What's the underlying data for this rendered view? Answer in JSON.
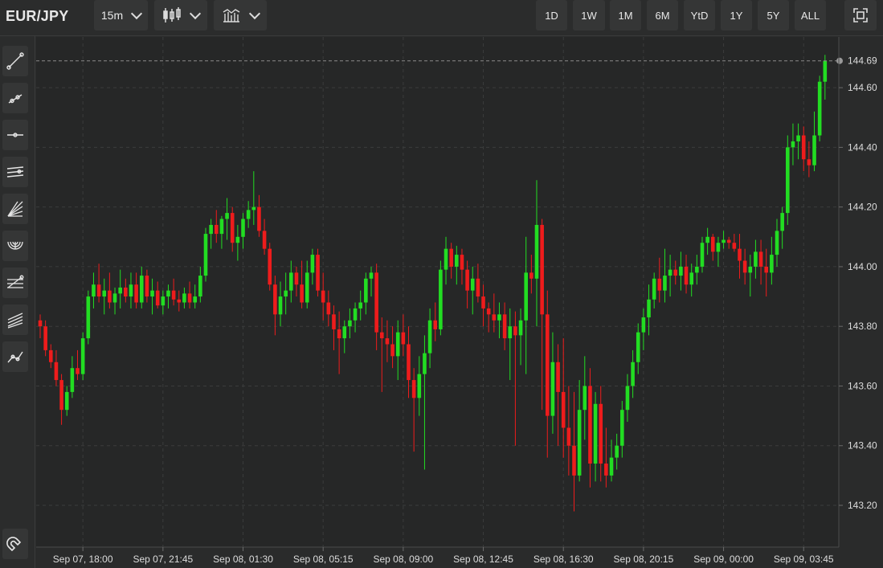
{
  "header": {
    "symbol": "EUR/JPY",
    "interval_label": "15m",
    "chart_style_icon": "candlestick-icon",
    "indicators_icon": "indicators-icon",
    "ranges": [
      "1D",
      "1W",
      "1M",
      "6M",
      "YtD",
      "1Y",
      "5Y",
      "ALL"
    ],
    "fullscreen_icon": "fullscreen-icon"
  },
  "sidebar": {
    "tools": [
      "trend-line-icon",
      "ray-icon",
      "horizontal-line-icon",
      "parallel-channel-icon",
      "fibonacci-fan-icon",
      "fibonacci-arcs-icon",
      "fibonacci-retracement-icon",
      "pitchfork-icon",
      "polyline-icon"
    ],
    "bottom_tool": "magnet-icon"
  },
  "colors": {
    "background": "#262727",
    "up": "#22dd22",
    "down": "#ee1c1c",
    "grid": "#3b3c3c",
    "price_line": "#8a8a8a"
  },
  "chart_data": {
    "type": "candlestick",
    "symbol": "EUR/JPY",
    "interval": "15m",
    "last_price": 144.69,
    "y_ticks": [
      143.2,
      143.4,
      143.6,
      143.8,
      144.0,
      144.2,
      144.4,
      144.6
    ],
    "y_tick_labels": [
      "143.20",
      "143.40",
      "143.60",
      "143.80",
      "144.00",
      "144.20",
      "144.40",
      "144.60"
    ],
    "ylim": [
      143.06,
      144.77
    ],
    "x_tick_labels": [
      "Sep 07, 18:00",
      "Sep 07, 21:45",
      "Sep 08, 01:30",
      "Sep 08, 05:15",
      "Sep 08, 09:00",
      "Sep 08, 12:45",
      "Sep 08, 16:30",
      "Sep 08, 20:15",
      "Sep 09, 00:00",
      "Sep 09, 03:45"
    ],
    "x_tick_bar_index": [
      8,
      23,
      38,
      53,
      68,
      83,
      98,
      113,
      128,
      143
    ],
    "grid": true,
    "candles": [
      [
        143.82,
        143.84,
        143.76,
        143.8
      ],
      [
        143.8,
        143.82,
        143.7,
        143.72
      ],
      [
        143.72,
        143.74,
        143.66,
        143.68
      ],
      [
        143.68,
        143.72,
        143.6,
        143.62
      ],
      [
        143.62,
        143.64,
        143.47,
        143.52
      ],
      [
        143.52,
        143.6,
        143.5,
        143.58
      ],
      [
        143.58,
        143.7,
        143.56,
        143.66
      ],
      [
        143.66,
        143.72,
        143.62,
        143.64
      ],
      [
        143.64,
        143.78,
        143.62,
        143.76
      ],
      [
        143.76,
        143.92,
        143.74,
        143.9
      ],
      [
        143.9,
        143.98,
        143.86,
        143.94
      ],
      [
        143.94,
        144.01,
        143.88,
        143.9
      ],
      [
        143.9,
        143.96,
        143.84,
        143.92
      ],
      [
        143.92,
        143.98,
        143.86,
        143.88
      ],
      [
        143.88,
        143.93,
        143.84,
        143.91
      ],
      [
        143.91,
        143.99,
        143.86,
        143.93
      ],
      [
        143.93,
        143.96,
        143.88,
        143.9
      ],
      [
        143.9,
        143.98,
        143.86,
        143.94
      ],
      [
        143.94,
        143.98,
        143.86,
        143.88
      ],
      [
        143.88,
        144.0,
        143.86,
        143.97
      ],
      [
        143.97,
        143.99,
        143.88,
        143.9
      ],
      [
        143.9,
        143.96,
        143.84,
        143.92
      ],
      [
        143.92,
        143.95,
        143.86,
        143.87
      ],
      [
        143.87,
        143.92,
        143.84,
        143.9
      ],
      [
        143.9,
        143.94,
        143.86,
        143.92
      ],
      [
        143.92,
        143.96,
        143.87,
        143.89
      ],
      [
        143.89,
        143.92,
        143.85,
        143.88
      ],
      [
        143.88,
        143.93,
        143.86,
        143.91
      ],
      [
        143.91,
        143.95,
        143.86,
        143.88
      ],
      [
        143.88,
        143.94,
        143.86,
        143.9
      ],
      [
        143.9,
        144.0,
        143.88,
        143.97
      ],
      [
        143.97,
        144.13,
        143.95,
        144.11
      ],
      [
        144.11,
        144.16,
        144.06,
        144.14
      ],
      [
        144.14,
        144.19,
        144.08,
        144.11
      ],
      [
        144.11,
        144.17,
        144.06,
        144.16
      ],
      [
        144.16,
        144.23,
        144.09,
        144.18
      ],
      [
        144.18,
        144.2,
        144.05,
        144.08
      ],
      [
        144.08,
        144.14,
        144.02,
        144.1
      ],
      [
        144.1,
        144.18,
        144.06,
        144.16
      ],
      [
        144.16,
        144.22,
        144.13,
        144.19
      ],
      [
        144.19,
        144.32,
        144.14,
        144.2
      ],
      [
        144.2,
        144.24,
        144.1,
        144.12
      ],
      [
        144.12,
        144.16,
        144.04,
        144.06
      ],
      [
        144.06,
        144.08,
        143.92,
        143.94
      ],
      [
        143.94,
        143.97,
        143.77,
        143.84
      ],
      [
        143.84,
        143.95,
        143.8,
        143.9
      ],
      [
        143.9,
        143.98,
        143.84,
        143.92
      ],
      [
        143.92,
        144.02,
        143.88,
        143.98
      ],
      [
        143.98,
        144.0,
        143.9,
        143.94
      ],
      [
        143.94,
        144.02,
        143.86,
        143.88
      ],
      [
        143.88,
        144.02,
        143.86,
        143.98
      ],
      [
        143.98,
        144.06,
        143.94,
        144.04
      ],
      [
        144.04,
        144.06,
        143.9,
        143.92
      ],
      [
        143.92,
        143.98,
        143.82,
        143.88
      ],
      [
        143.88,
        143.92,
        143.8,
        143.84
      ],
      [
        143.84,
        143.87,
        143.72,
        143.79
      ],
      [
        143.79,
        143.85,
        143.64,
        143.76
      ],
      [
        143.76,
        143.82,
        143.71,
        143.8
      ],
      [
        143.8,
        143.86,
        143.76,
        143.82
      ],
      [
        143.82,
        143.88,
        143.78,
        143.86
      ],
      [
        143.86,
        143.92,
        143.82,
        143.88
      ],
      [
        143.88,
        143.98,
        143.84,
        143.96
      ],
      [
        143.96,
        144.0,
        143.9,
        143.98
      ],
      [
        143.98,
        144.01,
        143.72,
        143.78
      ],
      [
        143.78,
        143.83,
        143.58,
        143.76
      ],
      [
        143.76,
        143.82,
        143.68,
        143.74
      ],
      [
        143.74,
        143.8,
        143.66,
        143.7
      ],
      [
        143.7,
        143.82,
        143.62,
        143.78
      ],
      [
        143.78,
        143.84,
        143.7,
        143.74
      ],
      [
        143.74,
        143.8,
        143.56,
        143.62
      ],
      [
        143.62,
        143.66,
        143.38,
        143.56
      ],
      [
        143.56,
        143.7,
        143.5,
        143.64
      ],
      [
        143.64,
        143.77,
        143.32,
        143.71
      ],
      [
        143.71,
        143.86,
        143.66,
        143.82
      ],
      [
        143.82,
        143.88,
        143.75,
        143.79
      ],
      [
        143.79,
        144.02,
        143.77,
        143.99
      ],
      [
        143.99,
        144.1,
        143.94,
        144.06
      ],
      [
        144.06,
        144.08,
        143.96,
        144.0
      ],
      [
        144.0,
        144.07,
        143.94,
        144.04
      ],
      [
        144.04,
        144.06,
        143.94,
        143.99
      ],
      [
        143.99,
        144.02,
        143.86,
        143.92
      ],
      [
        143.92,
        144.0,
        143.84,
        143.96
      ],
      [
        143.96,
        144.01,
        143.88,
        143.9
      ],
      [
        143.9,
        143.94,
        143.8,
        143.86
      ],
      [
        143.86,
        143.88,
        143.78,
        143.84
      ],
      [
        143.84,
        143.91,
        143.78,
        143.82
      ],
      [
        143.82,
        143.88,
        143.76,
        143.84
      ],
      [
        143.84,
        143.88,
        143.72,
        143.76
      ],
      [
        143.76,
        143.86,
        143.62,
        143.8
      ],
      [
        143.8,
        143.85,
        143.4,
        143.77
      ],
      [
        143.77,
        143.86,
        143.67,
        143.82
      ],
      [
        143.82,
        144.1,
        143.64,
        143.98
      ],
      [
        143.98,
        144.04,
        143.91,
        143.96
      ],
      [
        143.96,
        144.29,
        143.8,
        144.14
      ],
      [
        144.14,
        144.16,
        143.52,
        143.84
      ],
      [
        143.84,
        143.92,
        143.36,
        143.5
      ],
      [
        143.5,
        143.78,
        143.44,
        143.68
      ],
      [
        143.68,
        143.74,
        143.4,
        143.58
      ],
      [
        143.58,
        143.76,
        143.36,
        143.46
      ],
      [
        143.46,
        143.6,
        143.3,
        143.4
      ],
      [
        143.4,
        143.58,
        143.18,
        143.3
      ],
      [
        143.3,
        143.62,
        143.28,
        143.52
      ],
      [
        143.52,
        143.7,
        143.42,
        143.6
      ],
      [
        143.6,
        143.66,
        143.26,
        143.34
      ],
      [
        143.34,
        143.58,
        143.28,
        143.54
      ],
      [
        143.54,
        143.6,
        143.28,
        143.34
      ],
      [
        143.34,
        143.46,
        143.26,
        143.3
      ],
      [
        143.3,
        143.42,
        143.28,
        143.36
      ],
      [
        143.36,
        143.44,
        143.32,
        143.4
      ],
      [
        143.4,
        143.55,
        143.36,
        143.52
      ],
      [
        143.52,
        143.64,
        143.48,
        143.6
      ],
      [
        143.6,
        143.72,
        143.56,
        143.68
      ],
      [
        143.68,
        143.81,
        143.64,
        143.78
      ],
      [
        143.78,
        143.86,
        143.72,
        143.83
      ],
      [
        143.83,
        143.94,
        143.77,
        143.89
      ],
      [
        143.89,
        143.98,
        143.86,
        143.96
      ],
      [
        143.96,
        144.03,
        143.88,
        143.92
      ],
      [
        143.92,
        144.06,
        143.88,
        143.97
      ],
      [
        143.97,
        144.04,
        143.9,
        143.99
      ],
      [
        143.99,
        144.02,
        143.94,
        143.97
      ],
      [
        143.97,
        144.05,
        143.92,
        144.0
      ],
      [
        144.0,
        144.04,
        143.91,
        143.94
      ],
      [
        143.94,
        144.01,
        143.9,
        143.98
      ],
      [
        143.98,
        144.04,
        143.94,
        144.0
      ],
      [
        144.0,
        144.1,
        143.98,
        144.08
      ],
      [
        144.08,
        144.13,
        144.04,
        144.1
      ],
      [
        144.1,
        144.11,
        144.02,
        144.05
      ],
      [
        144.05,
        144.1,
        144.0,
        144.08
      ],
      [
        144.08,
        144.12,
        144.06,
        144.09
      ],
      [
        144.09,
        144.1,
        144.06,
        144.08
      ],
      [
        144.08,
        144.11,
        144.05,
        144.06
      ],
      [
        144.06,
        144.11,
        143.96,
        144.02
      ],
      [
        144.02,
        144.06,
        143.94,
        143.98
      ],
      [
        143.98,
        144.04,
        143.9,
        144.0
      ],
      [
        144.0,
        144.09,
        143.96,
        144.05
      ],
      [
        144.05,
        144.09,
        143.94,
        144.0
      ],
      [
        144.0,
        144.06,
        143.9,
        143.98
      ],
      [
        143.98,
        144.1,
        143.94,
        144.04
      ],
      [
        144.04,
        144.16,
        144.0,
        144.12
      ],
      [
        144.12,
        144.2,
        144.06,
        144.18
      ],
      [
        144.18,
        144.44,
        144.14,
        144.4
      ],
      [
        144.4,
        144.48,
        144.34,
        144.42
      ],
      [
        144.42,
        144.48,
        144.36,
        144.44
      ],
      [
        144.44,
        144.47,
        144.32,
        144.36
      ],
      [
        144.36,
        144.42,
        144.3,
        144.34
      ],
      [
        144.34,
        144.52,
        144.32,
        144.44
      ],
      [
        144.44,
        144.64,
        144.42,
        144.62
      ],
      [
        144.62,
        144.71,
        144.56,
        144.69
      ]
    ]
  }
}
